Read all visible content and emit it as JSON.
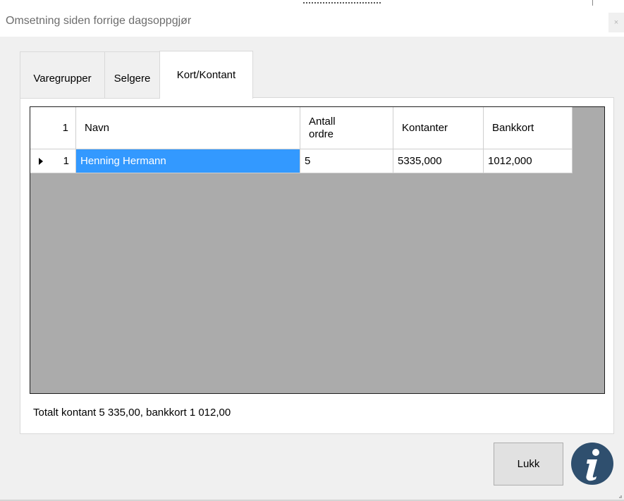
{
  "window": {
    "title": "Omsetning siden forrige dagsoppgjør",
    "close_glyph": "×"
  },
  "tabs": [
    {
      "label": "Varegrupper",
      "selected": false
    },
    {
      "label": "Selgere",
      "selected": false
    },
    {
      "label": "Kort/Kontant",
      "selected": true
    }
  ],
  "grid": {
    "header_rowcount": "1",
    "columns": [
      "Navn",
      "Antall ordre",
      "Kontanter",
      "Bankkort"
    ],
    "rows": [
      {
        "row_number": "1",
        "cells": [
          "Henning Hermann",
          "5",
          "5335,000",
          "1012,000"
        ]
      }
    ]
  },
  "summary": "Totalt kontant 5 335,00, bankkort 1 012,00",
  "buttons": {
    "close_label": "Lukk"
  },
  "icons": {
    "info": "info-icon",
    "row_selector": "row-selector-arrow-icon"
  },
  "colors": {
    "selection": "#3399ff",
    "grid_background": "#ababab",
    "info_icon": "#2f4f6e"
  }
}
